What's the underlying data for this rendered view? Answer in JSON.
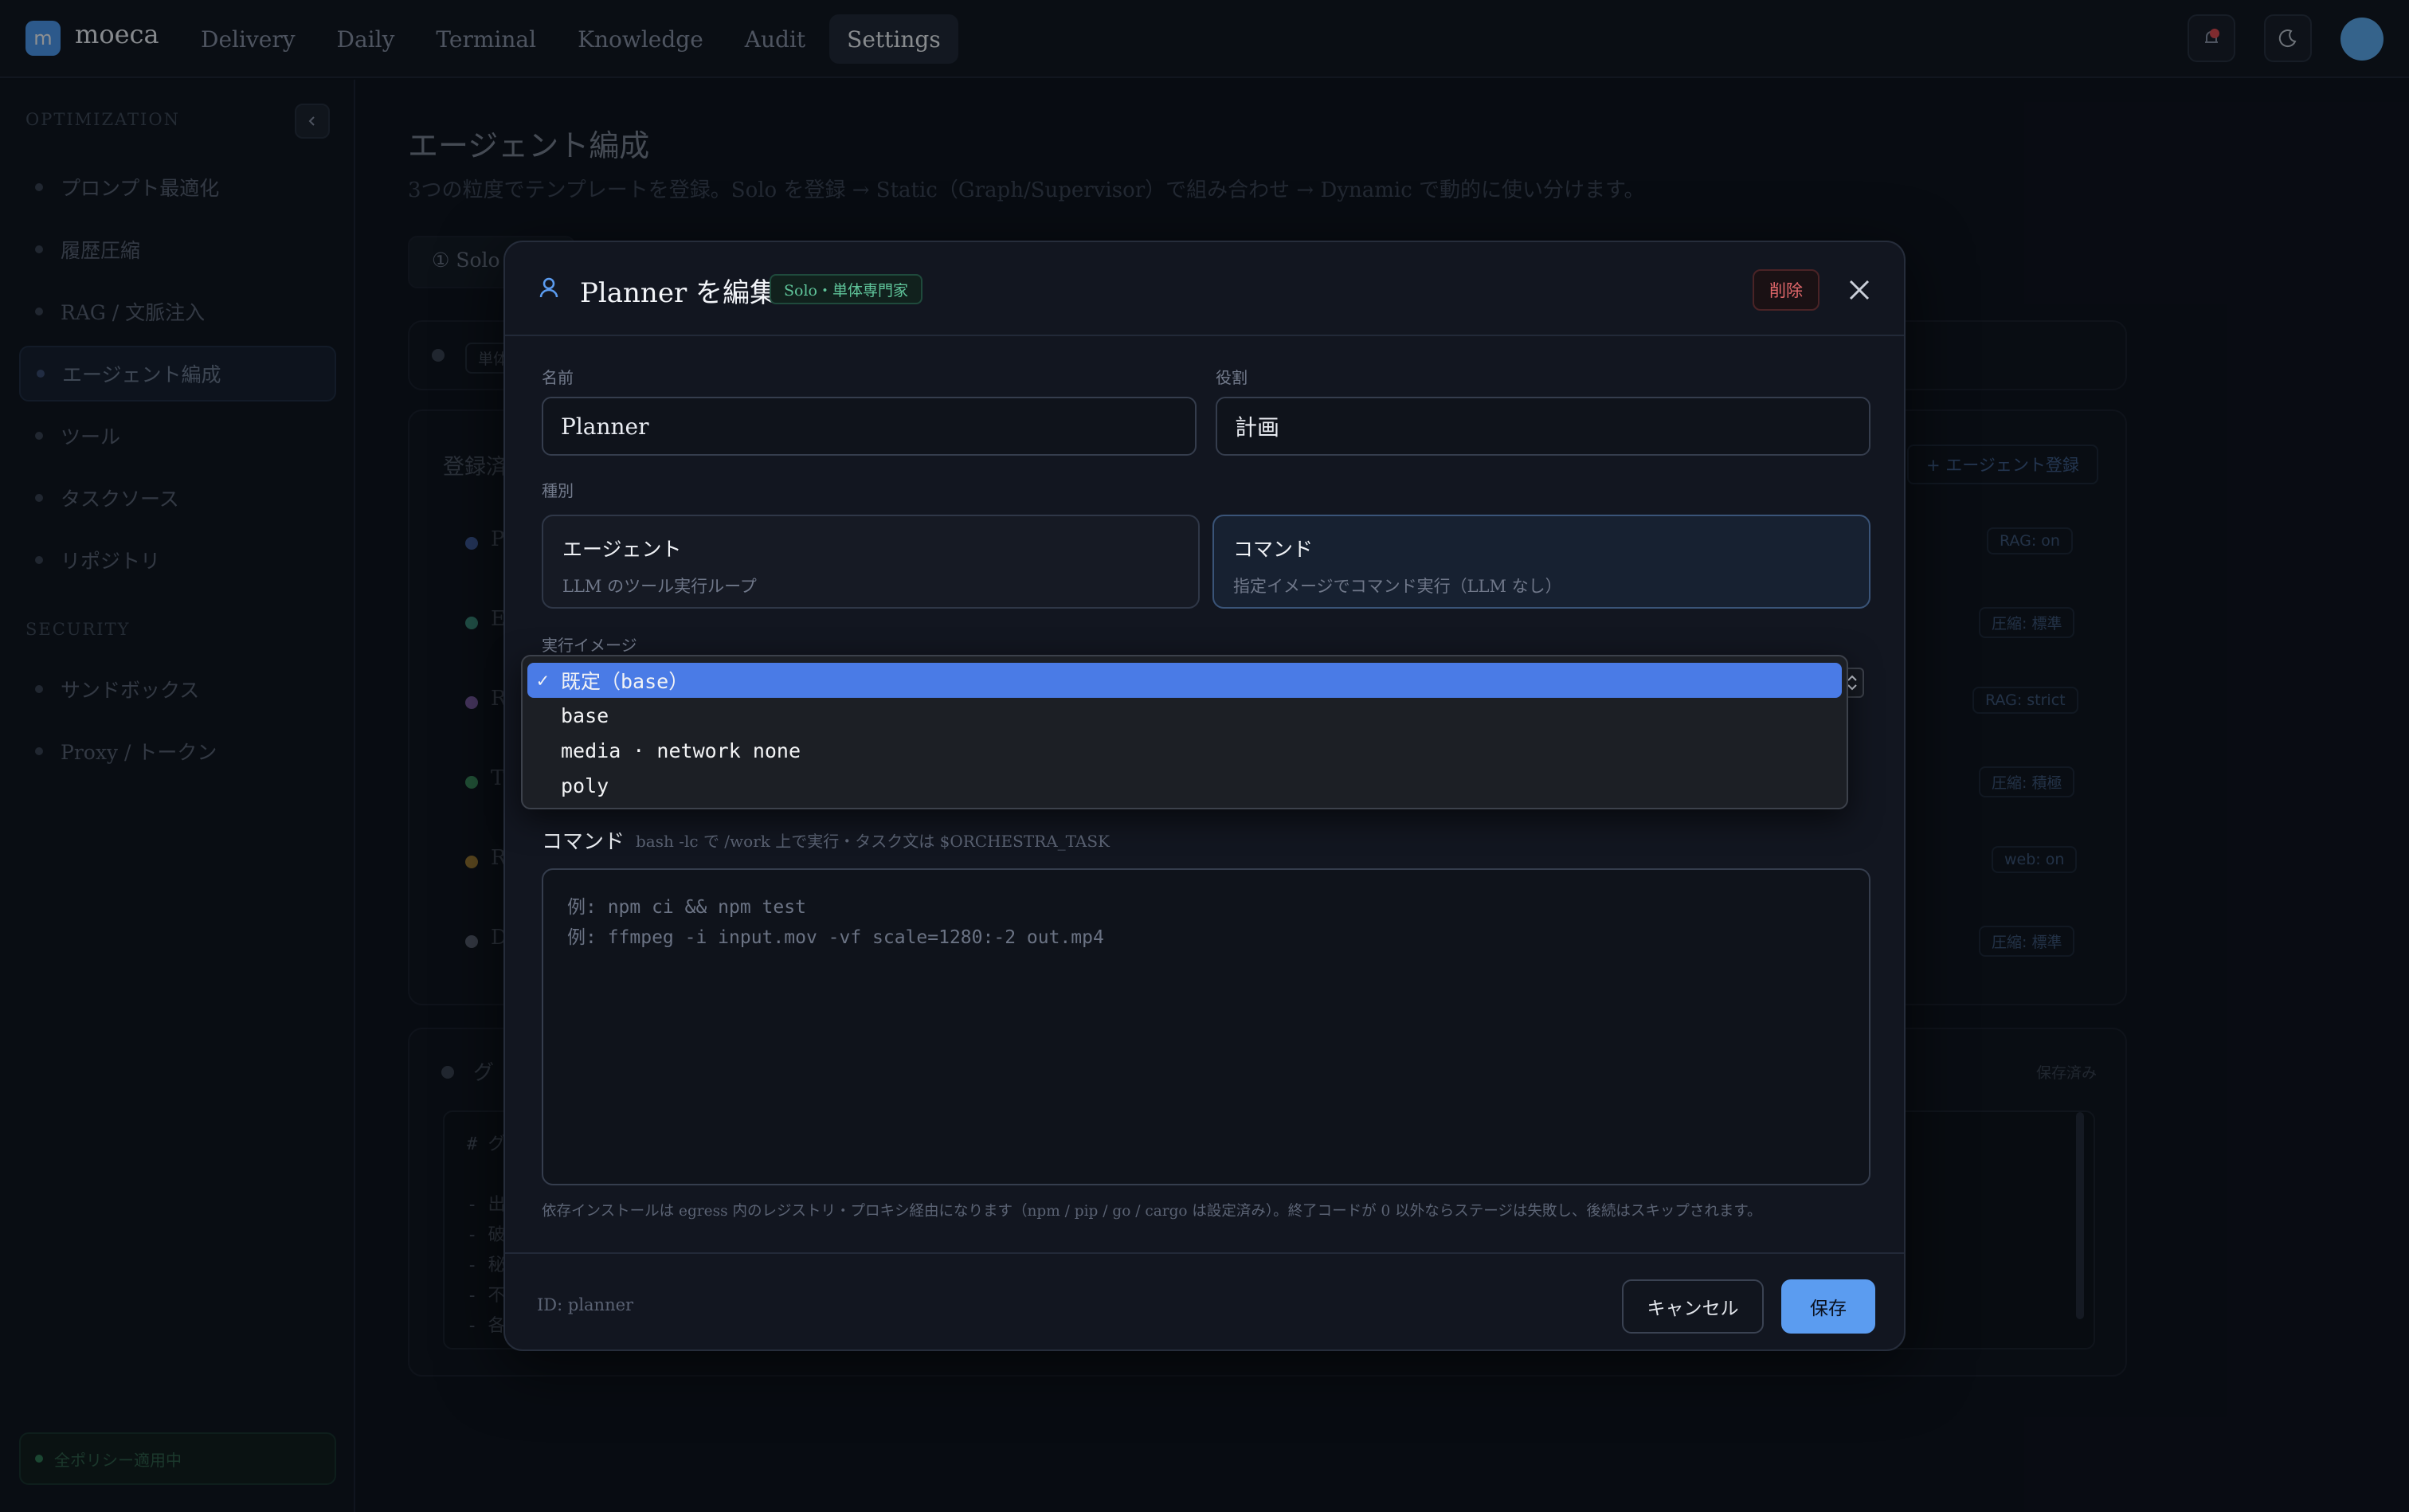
{
  "app": {
    "logo_letter": "m",
    "name": "moeca"
  },
  "nav": [
    {
      "label": "Delivery"
    },
    {
      "label": "Daily"
    },
    {
      "label": "Terminal"
    },
    {
      "label": "Knowledge"
    },
    {
      "label": "Audit"
    },
    {
      "label": "Settings",
      "active": true
    }
  ],
  "sidebar": {
    "sections": [
      "OPTIMIZATION",
      "SECURITY"
    ],
    "items": [
      {
        "label": "プロンプト最適化"
      },
      {
        "label": "履歴圧縮"
      },
      {
        "label": "RAG / 文脈注入"
      },
      {
        "label": "エージェント編成",
        "active": true
      },
      {
        "label": "ツール"
      },
      {
        "label": "タスクソース"
      },
      {
        "label": "リポジトリ"
      },
      {
        "label": "サンドボックス"
      },
      {
        "label": "Proxy / トークン"
      }
    ],
    "policy_status": "全ポリシー適用中"
  },
  "main": {
    "title": "エージェント編成",
    "subtitle": "3つの粒度でテンプレートを登録。Solo を登録 → Static（Graph/Supervisor）で組み合わせ → Dynamic で動的に使い分けます。",
    "tab_solo": "① Solo ∧",
    "chip_single": "単体",
    "registered_label": "登録済",
    "add_agent": "+ エージェント登録",
    "row_initials": [
      "P",
      "E",
      "R",
      "T",
      "R",
      "D"
    ],
    "row_dot_colors": [
      "#3e5a9a",
      "#3a8a78",
      "#7a5aa0",
      "#3a8a5a",
      "#a07a30",
      "#5a6070"
    ],
    "row_chips": [
      "RAG: on",
      "圧縮: 標準",
      "RAG: strict",
      "圧縮: 積極",
      "web: on",
      "圧縮: 標準"
    ],
    "group_label": "グ",
    "saved": "保存済み",
    "code_lines": [
      "# グ",
      "",
      "- 出",
      "- 破",
      "- 秘",
      "- 不",
      "- 各"
    ]
  },
  "modal": {
    "title": "Planner を編集",
    "badge": "Solo・単体専門家",
    "delete": "削除",
    "name_label": "名前",
    "name_value": "Planner",
    "role_label": "役割",
    "role_value": "計画",
    "kind_label": "種別",
    "kind_agent_title": "エージェント",
    "kind_agent_desc": "LLM のツール実行ループ",
    "kind_command_title": "コマンド",
    "kind_command_desc": "指定イメージでコマンド実行（LLM なし）",
    "image_label": "実行イメージ",
    "command_label": "コマンド",
    "command_hint": "bash -lc で /work 上で実行・タスク文は $ORCHESTRA_TASK",
    "command_placeholder": "例: npm ci && npm test\n例: ffmpeg -i input.mov -vf scale=1280:-2 out.mp4",
    "footnote": "依存インストールは egress 内のレジストリ・プロキシ経由になります（npm / pip / go / cargo は設定済み）。終了コードが 0 以外ならステージは失敗し、後続はスキップされます。",
    "id_text": "ID: planner",
    "cancel": "キャンセル",
    "save": "保存"
  },
  "dropdown": {
    "options": [
      {
        "label": "既定（base）",
        "selected": true
      },
      {
        "label": "base"
      },
      {
        "label": "media · network none"
      },
      {
        "label": "poly"
      }
    ],
    "check_glyph": "✓"
  },
  "colors": {
    "accent": "#5b9cf0",
    "selected_option": "#4a7be6",
    "danger": "#e0676a",
    "success": "#5fc49a"
  }
}
